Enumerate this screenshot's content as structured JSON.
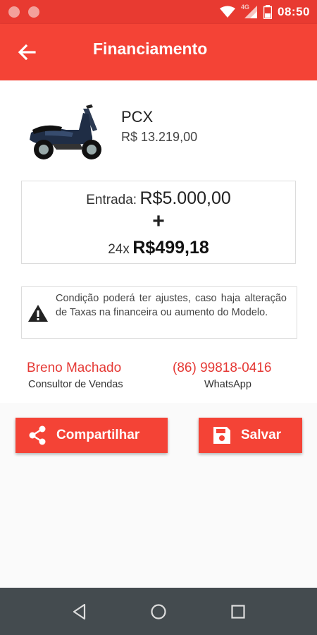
{
  "status_bar": {
    "network": "4G",
    "time": "08:50"
  },
  "app_bar": {
    "title": "Financiamento",
    "back_icon": "arrow-back-icon"
  },
  "product": {
    "name": "PCX",
    "price": "R$ 13.219,00",
    "image_icon": "scooter-image"
  },
  "financing": {
    "entrada_label": "Entrada:",
    "entrada_value": "R$5.000,00",
    "plus": "+",
    "parcel_count": "24x",
    "parcel_value": "R$499,18"
  },
  "warning": {
    "icon": "warning-icon",
    "text": "Condição poderá ter ajustes, caso haja alteração de Taxas na financeira ou aumento do Modelo."
  },
  "consultant": {
    "name": "Breno Machado",
    "role": "Consultor de Vendas",
    "phone": "(86) 99818-0416",
    "phone_label": "WhatsApp"
  },
  "actions": {
    "share_label": "Compartilhar",
    "save_label": "Salvar"
  },
  "colors": {
    "primary": "#f44336",
    "status_bar": "#e83a31",
    "accent_text": "#e53935",
    "nav_bar": "#444b4f"
  }
}
